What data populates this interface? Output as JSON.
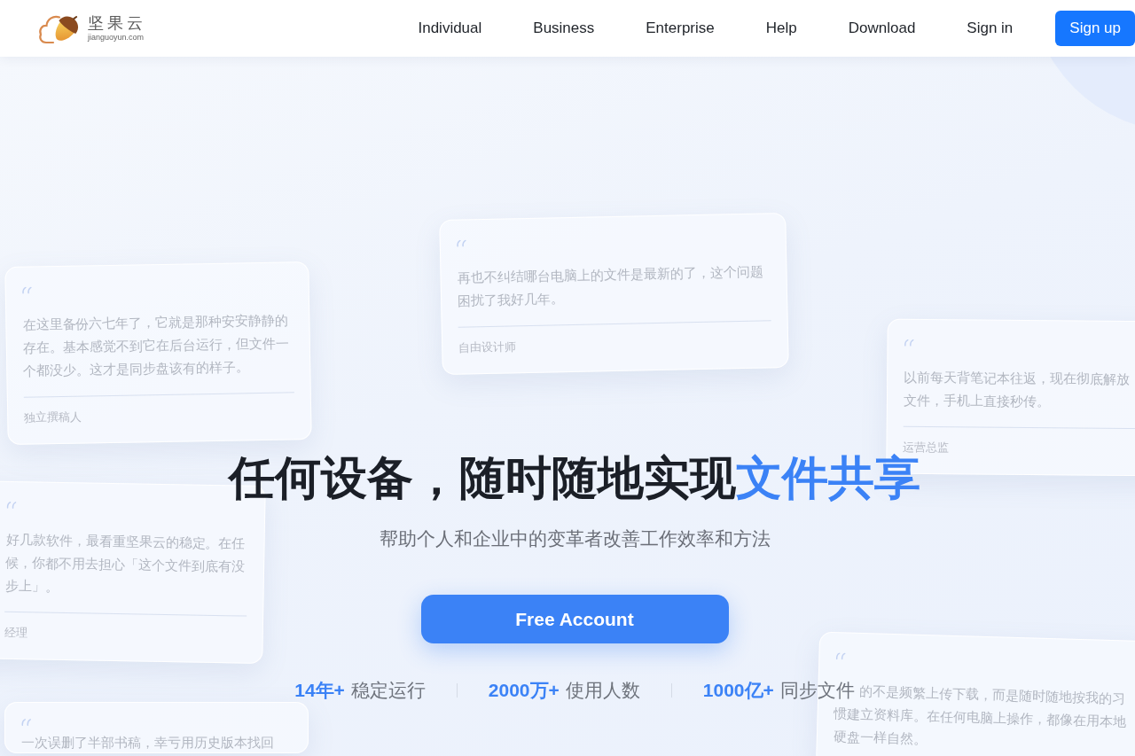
{
  "nav": {
    "logo": {
      "name": "坚果云",
      "domain": "jianguoyun.com"
    },
    "links": [
      {
        "label": "Individual"
      },
      {
        "label": "Business"
      },
      {
        "label": "Enterprise"
      },
      {
        "label": "Help"
      },
      {
        "label": "Download"
      },
      {
        "label": "Sign in"
      }
    ],
    "signup_button": "Sign up"
  },
  "hero": {
    "testimonials": [
      {
        "text": "再也不纠结哪台电脑上的文件是最新的了，这个问题困扰了我好几年。",
        "author": "自由设计师"
      },
      {
        "text": "在这里备份六七年了，它就是那种安安静静的存在。基本感觉不到它在后台运行，但文件一个都没少。这才是同步盘该有的样子。",
        "author": "独立撰稿人"
      },
      {
        "lines": [
          "以前每天背笔记本往返，现在彻底解放",
          "文件，手机上直接秒传。"
        ],
        "author": "运营总监"
      },
      {
        "lines": [
          "好几款软件，最看重坚果云的稳定。在任",
          "候，你都不用去担心「这个文件到底有没",
          "步上」。"
        ],
        "author": "经理"
      },
      {
        "lines": [
          "一次误删了半部书稿，幸亏用历史版本找回"
        ]
      },
      {
        "lines": [
          "的不是频繁上传下载，而是随时随地按我的习",
          "惯建立资料库。在任何电脑上操作，都像在用本地",
          "硬盘一样自然。"
        ]
      }
    ],
    "title_parts": [
      {
        "text": "任何设备，随时随地实现",
        "highlight": false
      },
      {
        "text": "文件共享",
        "highlight": true
      }
    ],
    "subtitle": "帮助个人和企业中的变革者改善工作效率和方法",
    "cta_button": "Free Account",
    "stats": [
      {
        "value": "14年+",
        "label": "稳定运行"
      },
      {
        "value": "2000万+",
        "label": "使用人数"
      },
      {
        "value": "1000亿+",
        "label": "同步文件"
      }
    ]
  }
}
